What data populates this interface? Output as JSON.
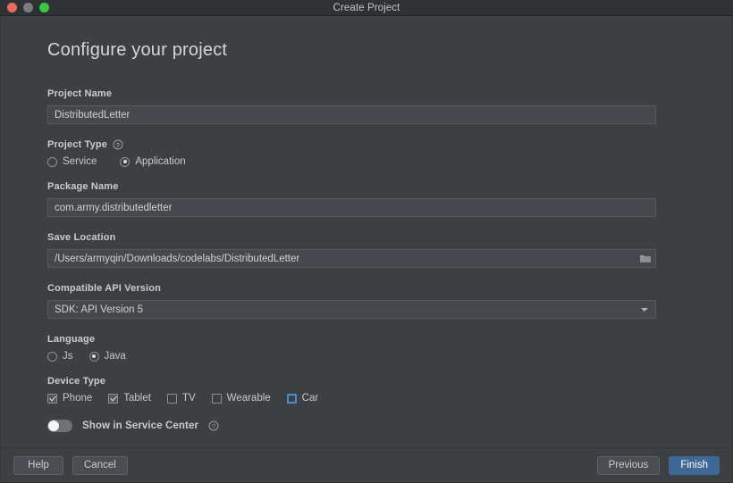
{
  "window": {
    "title": "Create Project",
    "traffic_lights": [
      "close",
      "minimize",
      "maximize"
    ]
  },
  "page": {
    "heading": "Configure your project"
  },
  "fields": {
    "project_name": {
      "label": "Project Name",
      "value": "DistributedLetter",
      "placeholder": "Enter project name"
    },
    "project_type": {
      "label": "Project Type",
      "help_icon": "help-circle-icon",
      "options": [
        {
          "label": "Service",
          "selected": false
        },
        {
          "label": "Application",
          "selected": true
        }
      ]
    },
    "package_name": {
      "label": "Package Name",
      "value": "com.army.distributedletter",
      "placeholder": "Enter package name"
    },
    "save_location": {
      "label": "Save Location",
      "value": "/Users/armyqin/Downloads/codelabs/DistributedLetter",
      "placeholder": "Choose a directory",
      "browse_icon": "folder-icon"
    },
    "api_version": {
      "label": "Compatible API Version",
      "value": "SDK: API Version 5",
      "dropdown_icon": "chevron-down-icon"
    },
    "language": {
      "label": "Language",
      "options": [
        {
          "label": "Js",
          "selected": false
        },
        {
          "label": "Java",
          "selected": true
        }
      ]
    },
    "device_type": {
      "label": "Device Type",
      "options": [
        {
          "label": "Phone",
          "checked": true,
          "focused": false
        },
        {
          "label": "Tablet",
          "checked": true,
          "focused": false
        },
        {
          "label": "TV",
          "checked": false,
          "focused": false
        },
        {
          "label": "Wearable",
          "checked": false,
          "focused": false
        },
        {
          "label": "Car",
          "checked": false,
          "focused": true
        }
      ]
    },
    "service_center": {
      "label": "Show in Service Center",
      "enabled": false,
      "help_icon": "help-circle-icon"
    }
  },
  "footer": {
    "help_label": "Help",
    "cancel_label": "Cancel",
    "previous_label": "Previous",
    "finish_label": "Finish"
  },
  "colors": {
    "window_bg": "#3c4043",
    "titlebar_bg": "#2f3235",
    "input_bg": "#45494d",
    "input_border": "#55595d",
    "text": "#c9ccd0",
    "accent_blue": "#3f6896",
    "focus_blue": "#4a8ccc",
    "traffic_close": "#ec6a5f",
    "traffic_min": "#7c7c7c",
    "traffic_max": "#3ac73f"
  }
}
